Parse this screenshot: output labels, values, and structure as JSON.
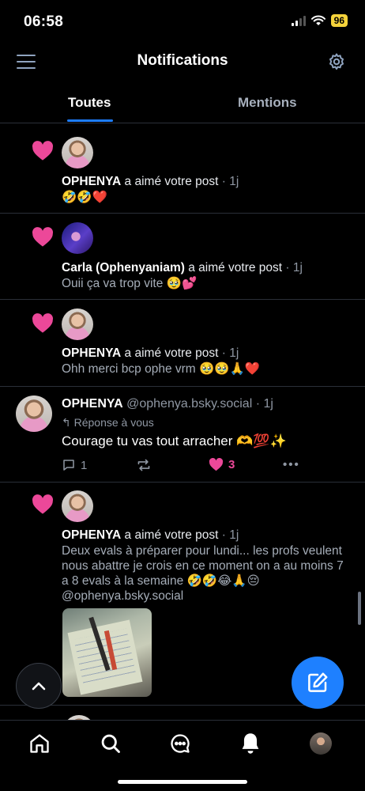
{
  "status_bar": {
    "time": "06:58",
    "battery": "96"
  },
  "header": {
    "title": "Notifications"
  },
  "tabs": [
    {
      "label": "Toutes"
    },
    {
      "label": "Mentions"
    }
  ],
  "notifications": [
    {
      "name": "OPHENYA",
      "action": " a aimé votre post",
      "time": " · 1j",
      "snippet": "🤣🤣❤️"
    },
    {
      "name": "Carla (Ophenyaniam)",
      "action": " a aimé votre post",
      "time": " · 1j",
      "snippet": "Ouii ça va trop vite 🥹💕"
    },
    {
      "name": "OPHENYA",
      "action": " a aimé votre post",
      "time": " · 1j",
      "snippet": "Ohh merci bcp ophe vrm 🥹🥹🙏❤️"
    },
    {
      "name": "OPHENYA",
      "action": " a aimé votre post",
      "time": " · 1j",
      "snippet": "Deux evals à préparer pour lundi... les profs veulent nous abattre je crois en ce moment on a au moins 7 a 8 evals à la semaine 🤣🤣😂🙏😔 @ophenya.bsky.social"
    }
  ],
  "reply_post": {
    "name": "OPHENYA",
    "handle": " @ophenya.bsky.social",
    "time": " · 1j",
    "reply_label": "Réponse à vous",
    "text": "Courage tu vas tout arracher 🫶💯✨",
    "reply_count": "1",
    "like_count": "3"
  },
  "icons": {
    "menu": "menu-icon",
    "settings": "gear-icon",
    "like": "heart-icon",
    "reply": "comment-icon",
    "repost": "repost-icon",
    "more": "more-icon",
    "scroll_top": "chevron-up-icon",
    "compose": "compose-icon",
    "home": "home-icon",
    "search": "search-icon",
    "messages": "chat-icon",
    "notifications": "bell-icon",
    "profile": "avatar"
  },
  "colors": {
    "accent": "#1e80ff",
    "like": "#ec4899",
    "background": "#000000",
    "muted": "#8f97a3"
  }
}
